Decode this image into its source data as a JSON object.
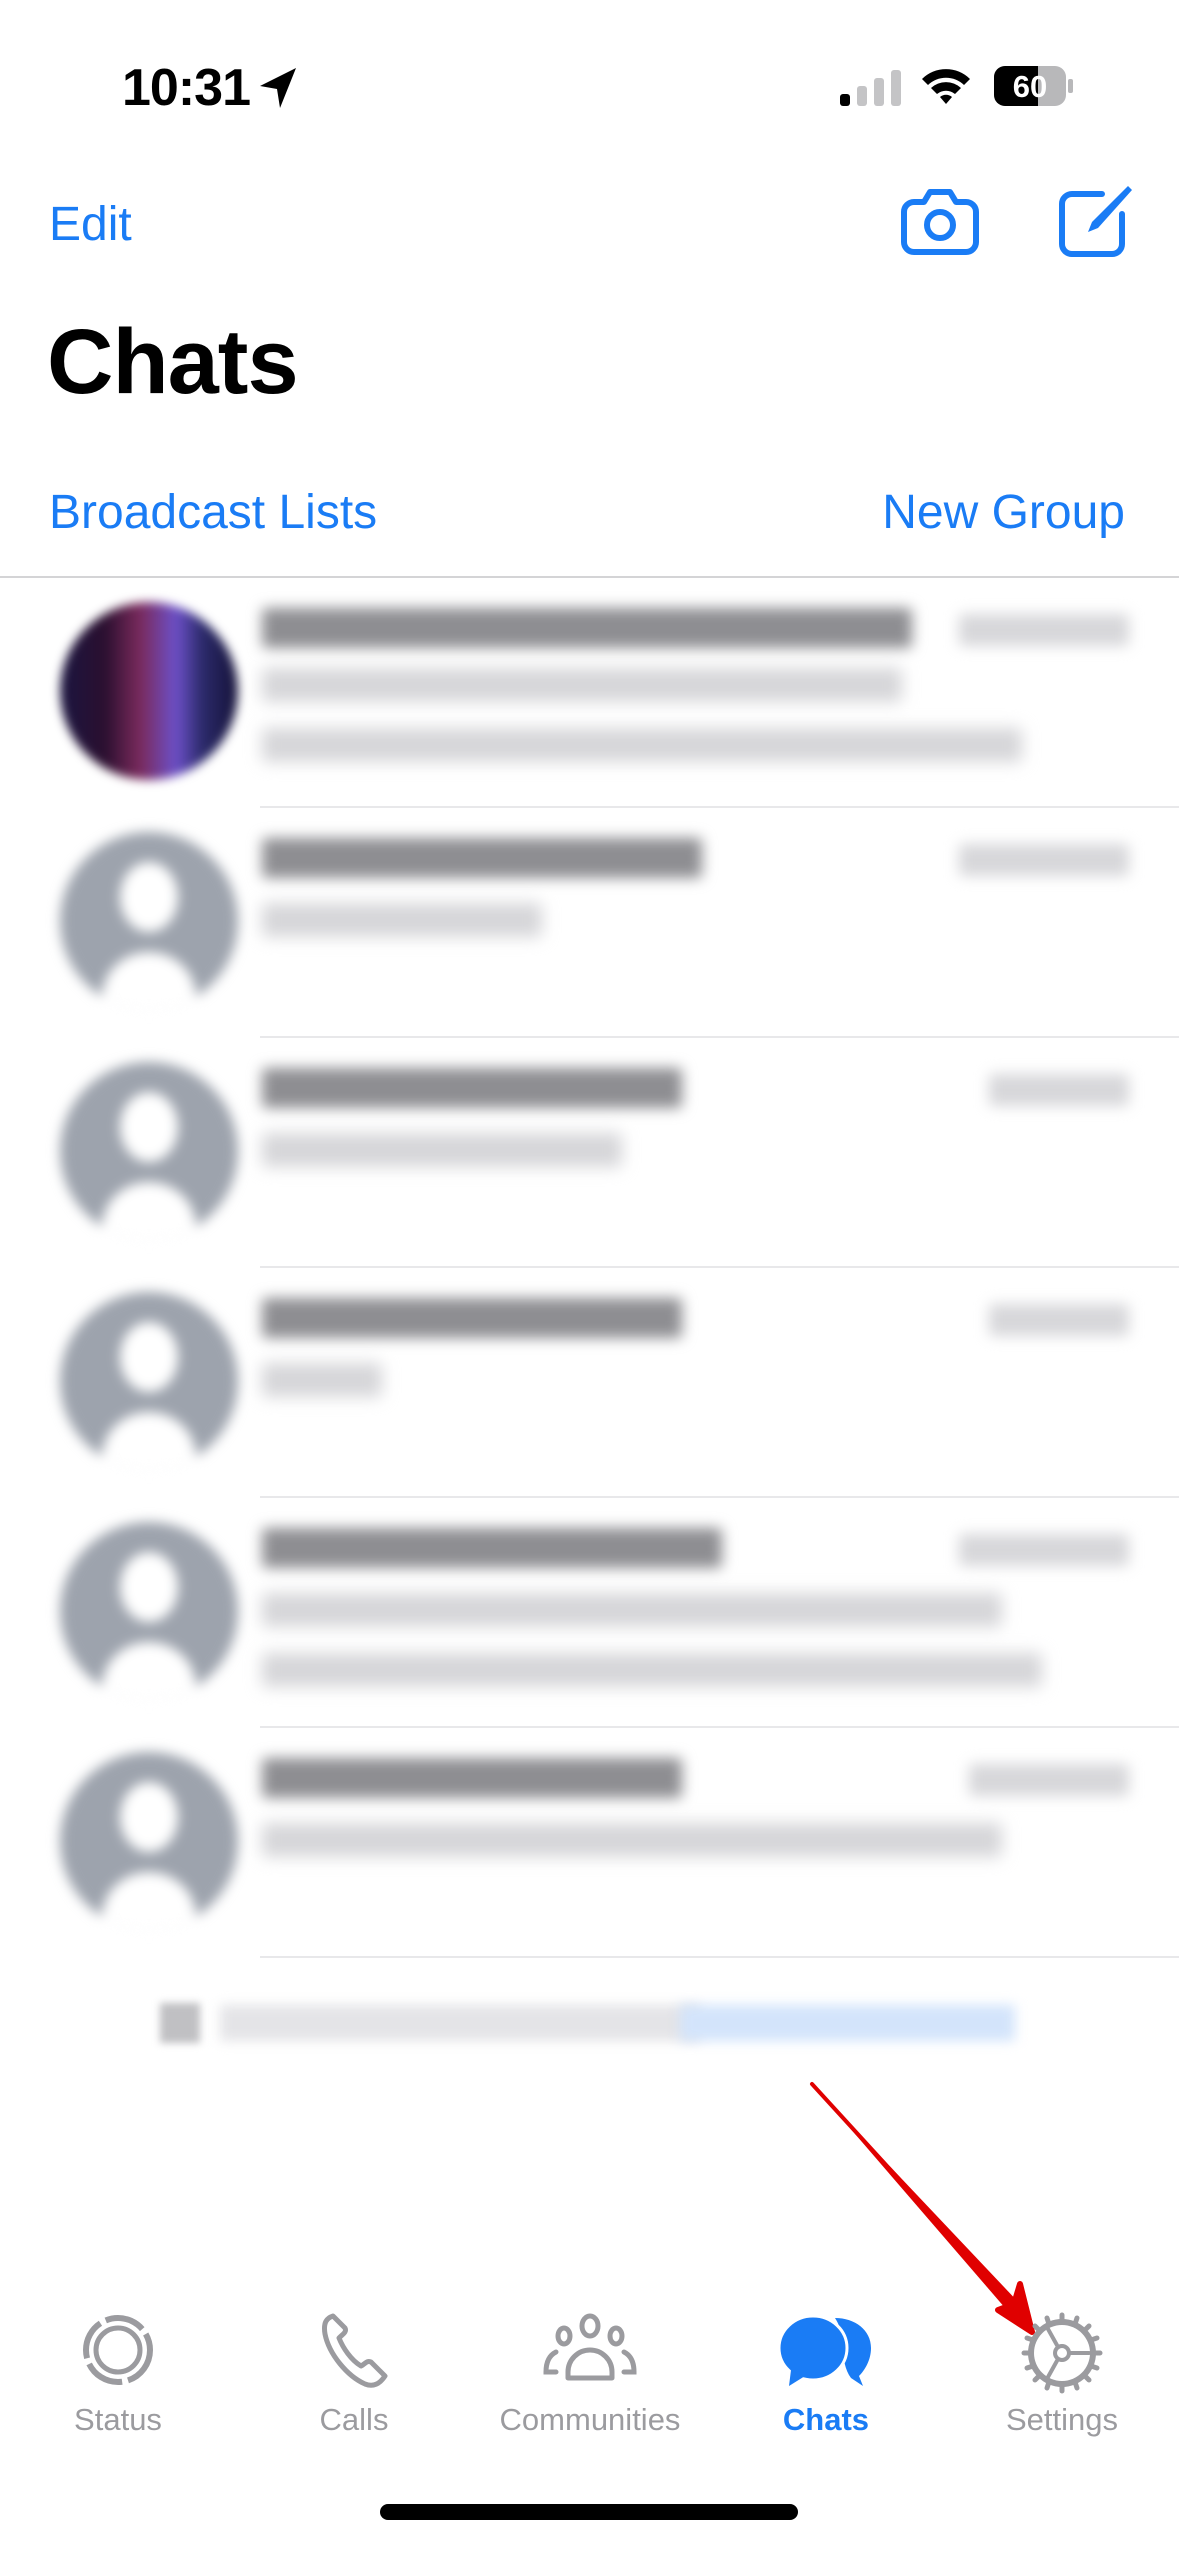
{
  "status_bar": {
    "time": "10:31",
    "location_icon": "location-arrow-icon",
    "signal_icon": "cellular-signal-icon",
    "signal_bars_active": 1,
    "signal_bars_total": 4,
    "wifi_icon": "wifi-icon",
    "battery_percent": "60"
  },
  "header": {
    "edit_label": "Edit",
    "camera_icon": "camera-icon",
    "compose_icon": "compose-icon",
    "title": "Chats",
    "broadcast_label": "Broadcast Lists",
    "new_group_label": "New Group"
  },
  "chats": [
    {
      "avatar": "photo",
      "name": "[redacted]",
      "timestamp": "[redacted]",
      "preview_lines": 2
    },
    {
      "avatar": "default",
      "name": "[redacted]",
      "timestamp": "[redacted]",
      "preview_lines": 1
    },
    {
      "avatar": "default",
      "name": "[redacted]",
      "timestamp": "[redacted]",
      "preview_lines": 1
    },
    {
      "avatar": "default",
      "name": "[redacted]",
      "timestamp": "[redacted]",
      "preview_lines": 1
    },
    {
      "avatar": "default",
      "name": "[redacted]",
      "timestamp": "[redacted]",
      "preview_lines": 2
    },
    {
      "avatar": "default",
      "name": "[redacted]",
      "timestamp": "[redacted]",
      "preview_lines": 1
    }
  ],
  "footer_note": "[redacted]",
  "tabs": [
    {
      "label": "Status",
      "icon": "status-icon",
      "active": false
    },
    {
      "label": "Calls",
      "icon": "phone-icon",
      "active": false
    },
    {
      "label": "Communities",
      "icon": "communities-icon",
      "active": false
    },
    {
      "label": "Chats",
      "icon": "chat-bubbles-icon",
      "active": true
    },
    {
      "label": "Settings",
      "icon": "gear-icon",
      "active": false
    }
  ],
  "colors": {
    "accent": "#1a7cf5",
    "inactive_tab": "#9b9b9f",
    "annotation_arrow": "#e00000"
  }
}
